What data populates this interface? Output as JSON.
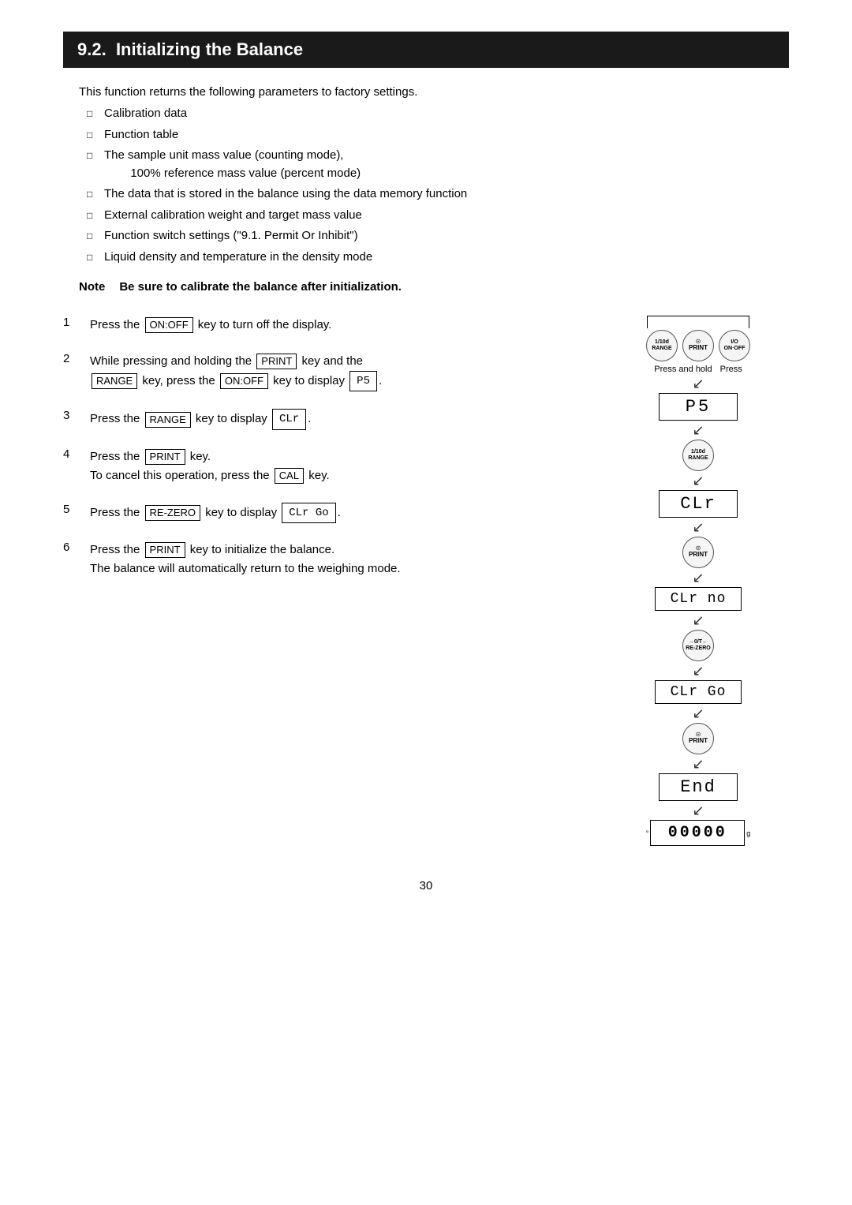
{
  "section": {
    "number": "9.2.",
    "title": "Initializing the Balance"
  },
  "intro": "This function returns the following parameters to factory settings.",
  "bullets": [
    "Calibration data",
    "Function table",
    "The sample unit mass value (counting mode),\n        100% reference mass value (percent mode)",
    "The data that is stored in the balance using the data memory function",
    "External calibration weight and target mass value",
    "Function switch settings (\"9.1. Permit Or Inhibit\")",
    "Liquid density and temperature in the density mode"
  ],
  "note": {
    "label": "Note",
    "text": "Be sure to calibrate the balance after initialization."
  },
  "steps": [
    {
      "num": "1",
      "text": "Press the",
      "key": "ON:OFF",
      "text2": "key to turn off the display."
    },
    {
      "num": "2",
      "text": "While pressing and holding the",
      "key1": "PRINT",
      "text2": "key and the",
      "key2": "RANGE",
      "text3": "key, press the",
      "key3": "ON:OFF",
      "text4": "key to display",
      "display": "P5"
    },
    {
      "num": "3",
      "text": "Press the",
      "key": "RANGE",
      "text2": "key to display",
      "display": "CLr"
    },
    {
      "num": "4",
      "text": "Press the",
      "key": "PRINT",
      "text2": "key.",
      "subtext": "To cancel this operation, press the",
      "subkey": "CAL",
      "subtext2": "key."
    },
    {
      "num": "5",
      "text": "Press the",
      "key": "RE-ZERO",
      "text2": "key to display",
      "display": "CLr Go"
    },
    {
      "num": "6",
      "text": "Press the",
      "key": "PRINT",
      "text2": "key to initialize the balance.",
      "subtext": "The balance will automatically return to the weighing mode."
    }
  ],
  "diagram": {
    "step1_keys": [
      "1/10d\nRANGE",
      "PRINT",
      "I/O\nON·OFF"
    ],
    "step1_label_left": "Press and hold",
    "step1_label_right": "Press",
    "step1_display": "P5",
    "step2_key": "1/10d\nRANGE",
    "step2_display": "CLr",
    "step3_key": "PRINT",
    "step3_display": "CLr no",
    "step4_key": "RE-ZERO",
    "step4_display": "CLr Go",
    "step5_key": "PRINT",
    "step5_display": "End",
    "final_display": "00000"
  },
  "page_number": "30"
}
